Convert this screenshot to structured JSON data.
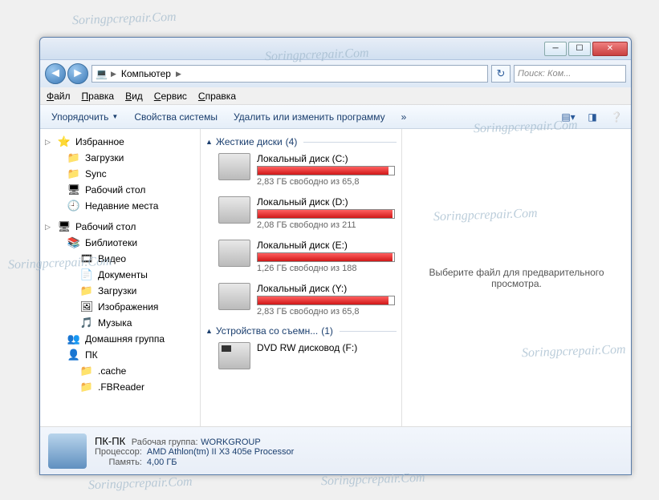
{
  "watermark": "Soringpcrepair.Com",
  "address": {
    "root_label": "Компьютер"
  },
  "search": {
    "placeholder": "Поиск: Ком..."
  },
  "menu": {
    "file": "Файл",
    "edit": "Правка",
    "view": "Вид",
    "tools": "Сервис",
    "help": "Справка"
  },
  "toolbar": {
    "organize": "Упорядочить",
    "sysprops": "Свойства системы",
    "uninstall": "Удалить или изменить программу",
    "more": "»"
  },
  "nav": {
    "favorites": "Избранное",
    "fav_items": [
      "Загрузки",
      "Sync",
      "Рабочий стол",
      "Недавние места"
    ],
    "desktop": "Рабочий стол",
    "libraries": "Библиотеки",
    "lib_items": [
      "Видео",
      "Документы",
      "Загрузки",
      "Изображения",
      "Музыка"
    ],
    "homegroup": "Домашняя группа",
    "pc": "ПК",
    "pc_items": [
      ".cache",
      ".FBReader"
    ]
  },
  "groups": {
    "hdd": {
      "label": "Жесткие диски",
      "count": "(4)"
    },
    "removable": {
      "label": "Устройства со съемн...",
      "count": "(1)"
    }
  },
  "drives": [
    {
      "name": "Локальный диск (C:)",
      "free": "2,83 ГБ свободно из 65,8",
      "fill": 96
    },
    {
      "name": "Локальный диск (D:)",
      "free": "2,08 ГБ свободно из 211",
      "fill": 99
    },
    {
      "name": "Локальный диск (E:)",
      "free": "1,26 ГБ свободно из 188",
      "fill": 99
    },
    {
      "name": "Локальный диск (Y:)",
      "free": "2,83 ГБ свободно из 65,8",
      "fill": 96
    }
  ],
  "dvd": {
    "name": "DVD RW дисковод (F:)"
  },
  "preview": {
    "empty": "Выберите файл для предварительного просмотра."
  },
  "details": {
    "title": "ПК-ПК",
    "workgroup_k": "Рабочая группа:",
    "workgroup_v": "WORKGROUP",
    "cpu_k": "Процессор:",
    "cpu_v": "AMD Athlon(tm) II X3 405e Processor",
    "mem_k": "Память:",
    "mem_v": "4,00 ГБ"
  }
}
